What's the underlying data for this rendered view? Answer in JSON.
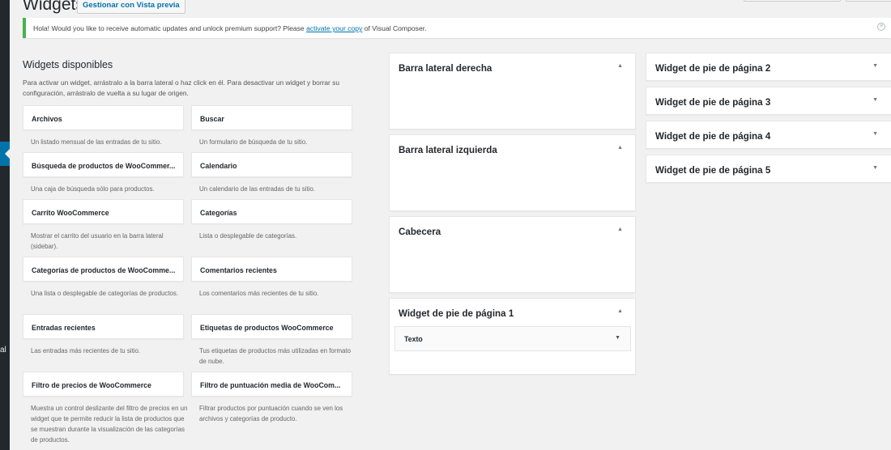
{
  "header": {
    "title": "Widgets",
    "preview_button": "Gestionar con Vista previa"
  },
  "admin_strip": {
    "partial_label": "al"
  },
  "notice": {
    "text_before": "Hola! Would you like to receive automatic updates and unlock premium support? Please ",
    "link_text": "activate your copy",
    "text_after": " of Visual Composer.",
    "dismiss_glyph": "⊗"
  },
  "available": {
    "title": "Widgets disponibles",
    "description": "Para activar un widget, arrástralo a la barra lateral o haz click en él. Para desactivar un widget y borrar su configuración, arrástralo de vuelta a su lugar de origen.",
    "widgets": [
      {
        "label": "Archivos",
        "desc": "Un listado mensual de las entradas de tu sitio."
      },
      {
        "label": "Buscar",
        "desc": "Un formulario de búsqueda de tu sitio."
      },
      {
        "label": "Búsqueda de productos de WooCommer...",
        "desc": "Una caja de búsqueda sólo para productos."
      },
      {
        "label": "Calendario",
        "desc": "Un calendario de las entradas de tu sitio."
      },
      {
        "label": "Carrito WooCommerce",
        "desc": "Mostrar el carrito del usuario en la barra lateral (sidebar)."
      },
      {
        "label": "Categorías",
        "desc": "Lista o desplegable de categorías."
      },
      {
        "label": "Categorías de productos de WooComme...",
        "desc": "Una lista o desplegable de categorías de productos."
      },
      {
        "label": "Comentarios recientes",
        "desc": "Los comentarios más recientes de tu sitio."
      },
      {
        "label": "Entradas recientes",
        "desc": "Las entradas más recientes de tu sitio."
      },
      {
        "label": "Etiquetas de productos WooCommerce",
        "desc": "Tus etiquetas de productos más utilizadas en formato de nube."
      },
      {
        "label": "Filtro de precios de WooCommerce",
        "desc": "Muestra un control deslizante del filtro de precios en un widget que te permite reducir la lista de productos que se muestran durante la visualización de las categorías de productos."
      },
      {
        "label": "Filtro de puntuación media de WooCom...",
        "desc": "Filtrar productos por puntuación cuando se ven los archivos y categorías de producto."
      }
    ]
  },
  "sidebars_left": [
    {
      "title": "Barra lateral derecha",
      "arrow": "▲"
    },
    {
      "title": "Barra lateral izquierda",
      "arrow": "▲"
    },
    {
      "title": "Cabecera",
      "arrow": "▲"
    },
    {
      "title": "Widget de pie de página 1",
      "arrow": "▲",
      "inner_widget": "Texto",
      "inner_arrow": "▼"
    }
  ],
  "sidebars_right": [
    {
      "title": "Widget de pie de página 2",
      "arrow": "▼"
    },
    {
      "title": "Widget de pie de página 3",
      "arrow": "▼"
    },
    {
      "title": "Widget de pie de página 4",
      "arrow": "▼"
    },
    {
      "title": "Widget de pie de página 5",
      "arrow": "▼"
    }
  ]
}
